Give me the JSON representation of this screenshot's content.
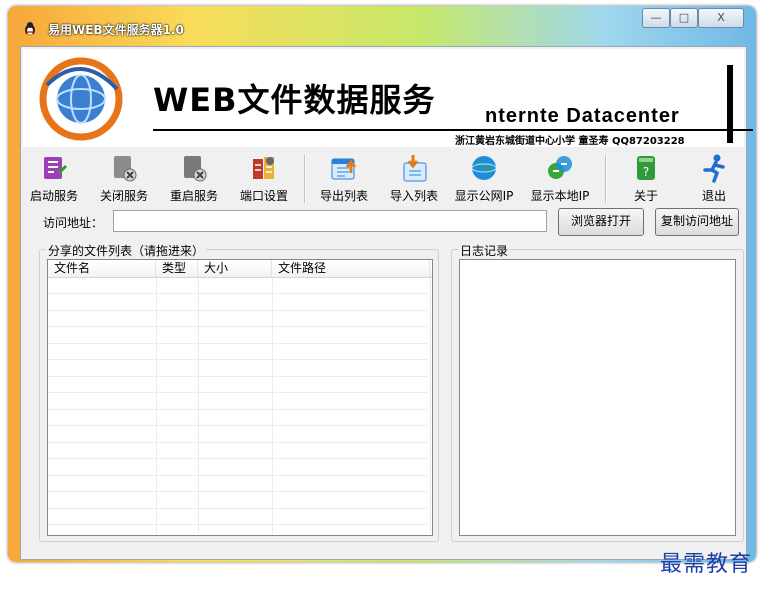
{
  "window": {
    "title": "易用WEB文件服务器1.0",
    "caption_buttons": {
      "minimize": "—",
      "maximize": "□",
      "close": "X"
    }
  },
  "banner": {
    "title": "WEB文件数据服务",
    "subtitle": "nternte  Datacenter",
    "credit": "浙江黄岩东城街道中心小学  童圣寿  QQ87203228"
  },
  "toolbar": {
    "items": [
      {
        "label": "启动服务",
        "icon": "start-service-icon",
        "color": "#9b3fb5"
      },
      {
        "label": "关闭服务",
        "icon": "stop-service-icon",
        "color": "#7a7a7a"
      },
      {
        "label": "重启服务",
        "icon": "restart-service-icon",
        "color": "#6f6f6f"
      },
      {
        "label": "端口设置",
        "icon": "port-settings-icon",
        "color": "#c0392b"
      },
      {
        "label": "导出列表",
        "icon": "export-list-icon",
        "color": "#2a7fd6"
      },
      {
        "label": "导入列表",
        "icon": "import-list-icon",
        "color": "#e07b1a"
      },
      {
        "label": "显示公网IP",
        "icon": "public-ip-globe-icon",
        "color": "#1c8fd6"
      },
      {
        "label": "显示本地IP",
        "icon": "local-ip-icon",
        "color": "#3aa63a"
      },
      {
        "label": "关于",
        "icon": "about-help-icon",
        "color": "#2f9a3a"
      },
      {
        "label": "退出",
        "icon": "exit-runner-icon",
        "color": "#1f6fd1"
      }
    ]
  },
  "address": {
    "label": "访问地址：",
    "value": "",
    "open_browser_label": "浏览器打开",
    "copy_address_label": "复制访问地址"
  },
  "shared_files": {
    "title": "分享的文件列表（请拖进来）",
    "columns": [
      "文件名",
      "类型",
      "大小",
      "文件路径"
    ],
    "rows": []
  },
  "log": {
    "title": "日志记录",
    "entries": []
  },
  "watermark": "最需教育"
}
